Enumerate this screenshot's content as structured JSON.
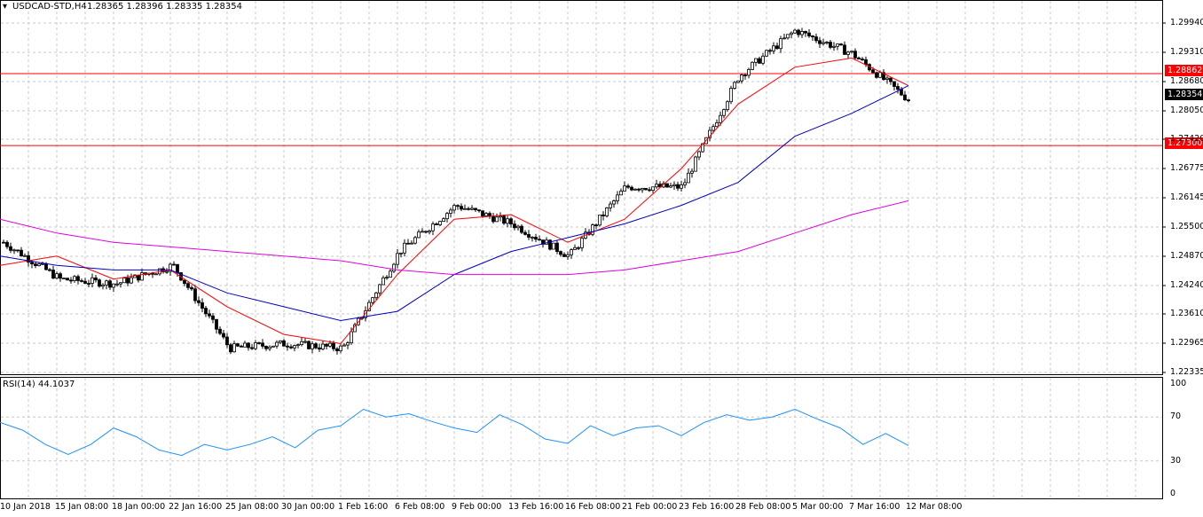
{
  "chart_header": {
    "symbol_timeframe": "USDCAD-STD,H4",
    "ohlc": "1.28365 1.28396 1.28335 1.28354"
  },
  "price_axis_labels": [
    "1.29940",
    "1.29310",
    "1.28680",
    "1.28050",
    "1.27420",
    "1.26775",
    "1.26145",
    "1.25500",
    "1.24870",
    "1.24240",
    "1.23610",
    "1.22965",
    "1.22335"
  ],
  "price_tags": {
    "upper_line": "1.28862",
    "bid": "1.28354",
    "lower_line": "1.27300"
  },
  "rsi": {
    "label": "RSI(14) 44.1037",
    "axis_labels": [
      "100",
      "70",
      "30",
      "0"
    ],
    "levels": [
      30,
      70
    ]
  },
  "time_axis_labels": [
    "10 Jan 2018",
    "15 Jan 08:00",
    "18 Jan 00:00",
    "22 Jan 16:00",
    "25 Jan 08:00",
    "30 Jan 00:00",
    "1 Feb 16:00",
    "6 Feb 08:00",
    "9 Feb 00:00",
    "13 Feb 16:00",
    "16 Feb 08:00",
    "21 Feb 00:00",
    "23 Feb 16:00",
    "28 Feb 08:00",
    "5 Mar 00:00",
    "7 Mar 16:00",
    "12 Mar 08:00"
  ],
  "colors": {
    "grid": "#c8c8c8",
    "candle": "#000000",
    "ma_fast": "#ff0000",
    "ma_mid": "#0000c0",
    "ma_slow": "#e000e0",
    "hline": "#ff0000",
    "rsi_line": "#1e90ff"
  },
  "chart_data": {
    "type": "line",
    "title": "USDCAD-STD,H4",
    "ylim": [
      1.22335,
      1.2994
    ],
    "x": [
      "10 Jan 2018",
      "15 Jan 08:00",
      "18 Jan 00:00",
      "22 Jan 16:00",
      "25 Jan 08:00",
      "30 Jan 00:00",
      "1 Feb 16:00",
      "6 Feb 08:00",
      "9 Feb 00:00",
      "13 Feb 16:00",
      "16 Feb 08:00",
      "21 Feb 00:00",
      "23 Feb 16:00",
      "28 Feb 08:00",
      "5 Mar 00:00",
      "7 Mar 16:00",
      "12 Mar 08:00"
    ],
    "series": [
      {
        "values": [
          1.252,
          1.244,
          1.243,
          1.247,
          1.229,
          1.23,
          1.229,
          1.25,
          1.26,
          1.256,
          1.249,
          1.264,
          1.264,
          1.288,
          1.298,
          1.293,
          1.283
        ]
      },
      {
        "values": [
          1.247,
          1.249,
          1.244,
          1.246,
          1.238,
          1.232,
          1.23,
          1.245,
          1.257,
          1.258,
          1.252,
          1.257,
          1.268,
          1.282,
          1.29,
          1.292,
          1.286
        ]
      },
      {
        "values": [
          1.249,
          1.247,
          1.246,
          1.246,
          1.241,
          1.238,
          1.235,
          1.237,
          1.245,
          1.25,
          1.253,
          1.256,
          1.26,
          1.265,
          1.275,
          1.28,
          1.286
        ]
      },
      {
        "values": [
          1.257,
          1.254,
          1.252,
          1.251,
          1.25,
          1.249,
          1.248,
          1.246,
          1.245,
          1.245,
          1.245,
          1.246,
          1.248,
          1.25,
          1.254,
          1.258,
          1.261
        ]
      }
    ],
    "hlines": [
      1.28862,
      1.273
    ],
    "rsi_ylim": [
      0,
      100
    ],
    "rsi_values": [
      65,
      58,
      45,
      36,
      45,
      60,
      52,
      40,
      35,
      45,
      40,
      45,
      52,
      42,
      58,
      62,
      77,
      70,
      73,
      66,
      60,
      56,
      72,
      63,
      50,
      46,
      62,
      53,
      60,
      62,
      53,
      65,
      72,
      67,
      70,
      77,
      68,
      60,
      45,
      55,
      44
    ]
  }
}
